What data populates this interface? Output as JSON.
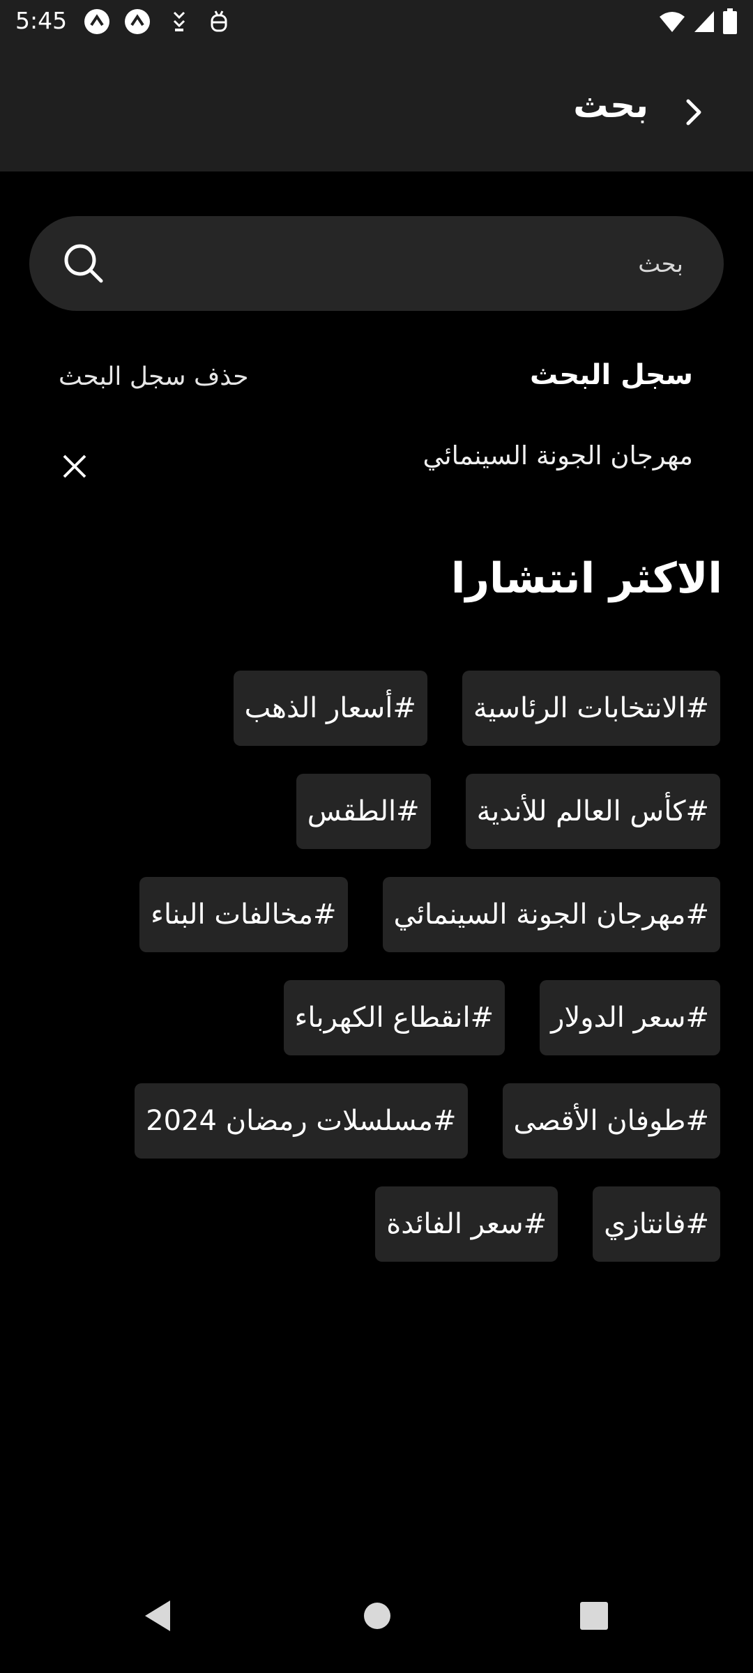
{
  "status": {
    "time": "5:45"
  },
  "app_bar": {
    "title": "بحث"
  },
  "search": {
    "placeholder": "بحث",
    "value": ""
  },
  "history": {
    "title": "سجل البحث",
    "clear_label": "حذف سجل البحث",
    "items": [
      {
        "label": "مهرجان الجونة السينمائي"
      }
    ]
  },
  "trending": {
    "title": "الاكثر انتشارا",
    "rows": [
      [
        "#الانتخابات الرئاسية",
        "#أسعار الذهب"
      ],
      [
        "#كأس العالم للأندية",
        "#الطقس"
      ],
      [
        "#مهرجان الجونة السينمائي",
        "#مخالفات البناء"
      ],
      [
        "#سعر الدولار",
        "#انقطاع الكهرباء"
      ],
      [
        "#طوفان الأقصى",
        "#مسلسلات رمضان 2024"
      ],
      [
        "#فانتازي",
        "#سعر الفائدة"
      ]
    ]
  },
  "icons": {
    "status_left": [
      "notification-icon",
      "notification-icon",
      "data-saver-icon",
      "debug-icon"
    ],
    "status_right": [
      "wifi-icon",
      "signal-icon",
      "battery-icon"
    ],
    "back": "chevron-right-icon",
    "search": "search-icon",
    "remove": "close-icon",
    "nav": [
      "back-triangle-icon",
      "home-circle-icon",
      "recents-square-icon"
    ]
  },
  "colors": {
    "background": "#000000",
    "bar": "#1f1f1f",
    "surface": "#262626",
    "chip": "#252525",
    "text": "#ffffff"
  }
}
